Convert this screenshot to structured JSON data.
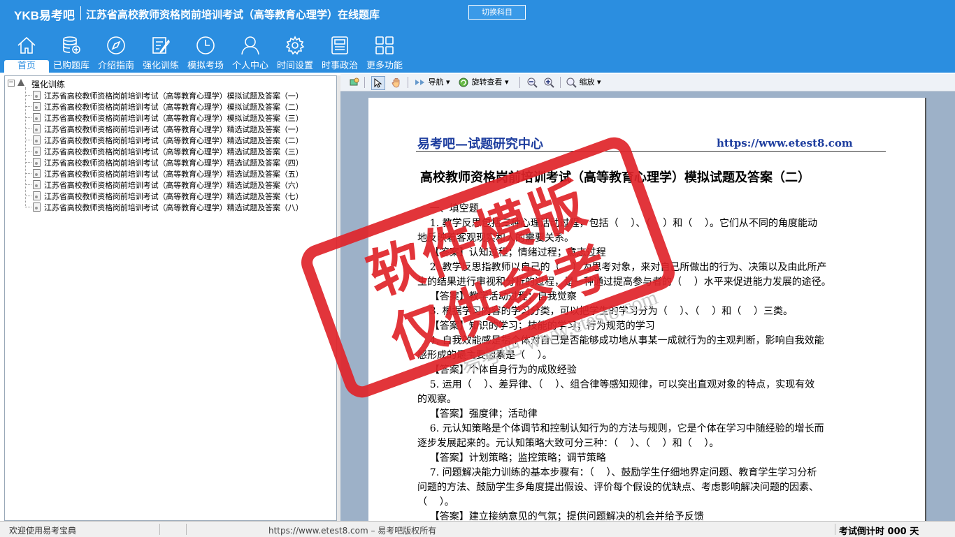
{
  "header": {
    "logo": "YKB易考吧",
    "title": "江苏省高校教师资格岗前培训考试（高等教育心理学）在线题库",
    "switch_label": "切换科目"
  },
  "nav": [
    {
      "label": "首页",
      "icon": "home-icon",
      "active": true
    },
    {
      "label": "已购题库",
      "icon": "database-icon"
    },
    {
      "label": "介绍指南",
      "icon": "compass-icon"
    },
    {
      "label": "强化训练",
      "icon": "edit-icon"
    },
    {
      "label": "模拟考场",
      "icon": "clock-icon"
    },
    {
      "label": "个人中心",
      "icon": "user-icon"
    },
    {
      "label": "时间设置",
      "icon": "gear-icon"
    },
    {
      "label": "时事政治",
      "icon": "news-icon"
    },
    {
      "label": "更多功能",
      "icon": "grid-icon"
    }
  ],
  "tree": {
    "root": "强化训练",
    "items": [
      "江苏省高校教师资格岗前培训考试（高等教育心理学）模拟试题及答案（一）",
      "江苏省高校教师资格岗前培训考试（高等教育心理学）模拟试题及答案（二）",
      "江苏省高校教师资格岗前培训考试（高等教育心理学）模拟试题及答案（三）",
      "江苏省高校教师资格岗前培训考试（高等教育心理学）精选试题及答案（一）",
      "江苏省高校教师资格岗前培训考试（高等教育心理学）精选试题及答案（二）",
      "江苏省高校教师资格岗前培训考试（高等教育心理学）精选试题及答案（三）",
      "江苏省高校教师资格岗前培训考试（高等教育心理学）精选试题及答案（四）",
      "江苏省高校教师资格岗前培训考试（高等教育心理学）精选试题及答案（五）",
      "江苏省高校教师资格岗前培训考试（高等教育心理学）精选试题及答案（六）",
      "江苏省高校教师资格岗前培训考试（高等教育心理学）精选试题及答案（七）",
      "江苏省高校教师资格岗前培训考试（高等教育心理学）精选试题及答案（八）"
    ]
  },
  "toolbar": {
    "navigate": "导航",
    "rotate": "旋转查看",
    "zoom": "缩放"
  },
  "document": {
    "brand": "易考吧—试题研究中心",
    "url": "https://www.etest8.com",
    "title": "高校教师资格岗前培训考试（高等教育心理学）模拟试题及答案（二）",
    "lines": [
      "    一、填空题",
      "    1. 教学反思包括三种心理活动过程，包括（    ）、（    ）和（    ）。它们从不同的角度能动",
      "地反映着客观现实和人的需要关系。",
      "    【答案】认知过程；情绪过程；意志过程",
      "    2. 教学反思指教师以自己的（    ）为思考对象，来对自己所做出的行为、决策以及由此所产",
      "生的结果进行审视和分析的过程，是一种通过提高参与者的（    ）水平来促进能力发展的途径。",
      "    【答案】教学活动过程；自我觉察",
      "    3. 根据学习内容的学习分类，可以把学生的学习分为（    ）、（    ）和（    ）三类。",
      "    【答案】知识的学习；技能的学习；行为规范的学习",
      "    4. 自我效能感是指个体对自己是否能够成功地从事某一成就行为的主观判断，影响自我效能",
      "感形成的最主要因素是（    ）。",
      "    【答案】个体自身行为的成败经验",
      "    5. 运用（    ）、差异律、（    ）、组合律等感知规律，可以突出直观对象的特点，实现有效",
      "的观察。",
      "    【答案】强度律；活动律",
      "    6. 元认知策略是个体调节和控制认知行为的方法与规则，它是个体在学习中随经验的增长而",
      "逐步发展起来的。元认知策略大致可分三种：（    ）、（    ）和（    ）。",
      "    【答案】计划策略；监控策略；调节策略",
      "    7. 问题解决能力训练的基本步骤有：（    ）、鼓励学生仔细地界定问题、教育学生学习分析",
      "问题的方法、鼓励学生多角度提出假设、评价每个假设的优缺点、考虑影响解决问题的因素、",
      "（    ）。",
      "    【答案】建立接纳意见的气氛；提供问题解决的机会并给予反馈"
    ],
    "stamp_line1": "软件模版",
    "stamp_line2": "仅供参考",
    "watermark": "易考吧 www.etest8.com"
  },
  "status": {
    "welcome": "欢迎使用易考宝典",
    "copyright": "https://www.etest8.com – 易考吧版权所有",
    "countdown": "考试倒计时 000 天"
  },
  "colors": {
    "header_bg": "#2b8ee0",
    "brand_blue": "#1d3d9e",
    "stamp_red": "#e0242a"
  }
}
